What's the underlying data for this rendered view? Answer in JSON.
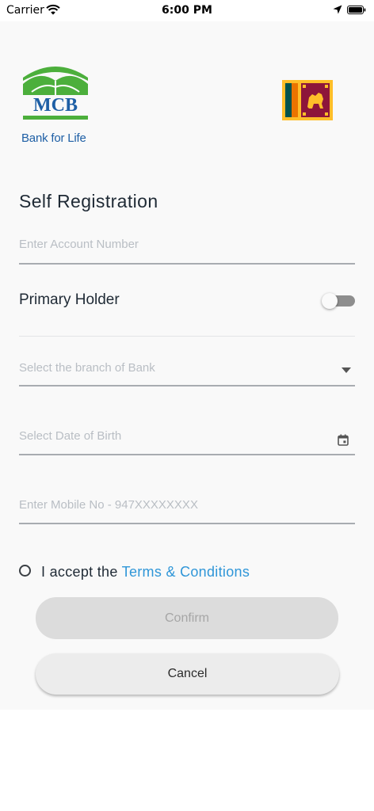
{
  "status_bar": {
    "carrier": "Carrier",
    "time": "6:00 PM"
  },
  "brand": {
    "logo_text": "MCB",
    "tagline": "Bank for Life",
    "logo_green": "#4caf3c",
    "logo_blue": "#1e5fa5"
  },
  "form": {
    "title": "Self Registration",
    "account_placeholder": "Enter Account Number",
    "primary_holder_label": "Primary Holder",
    "primary_holder_on": false,
    "branch_placeholder": "Select the branch of Bank",
    "dob_placeholder": "Select Date of Birth",
    "mobile_placeholder": "Enter Mobile No - 947XXXXXXXX",
    "terms_prefix": "I accept the",
    "terms_link": "Terms & Conditions",
    "terms_accepted": false
  },
  "buttons": {
    "confirm_label": "Confirm",
    "cancel_label": "Cancel"
  },
  "icons": {
    "wifi": "wifi-icon",
    "location": "location-arrow-icon",
    "battery": "battery-icon",
    "dropdown": "dropdown-arrow-icon",
    "calendar": "calendar-icon",
    "flag": "sri-lanka-flag"
  },
  "colors": {
    "link": "#2f96d8",
    "confirm_bg": "#dcdcdc",
    "cancel_bg": "#ececec"
  }
}
